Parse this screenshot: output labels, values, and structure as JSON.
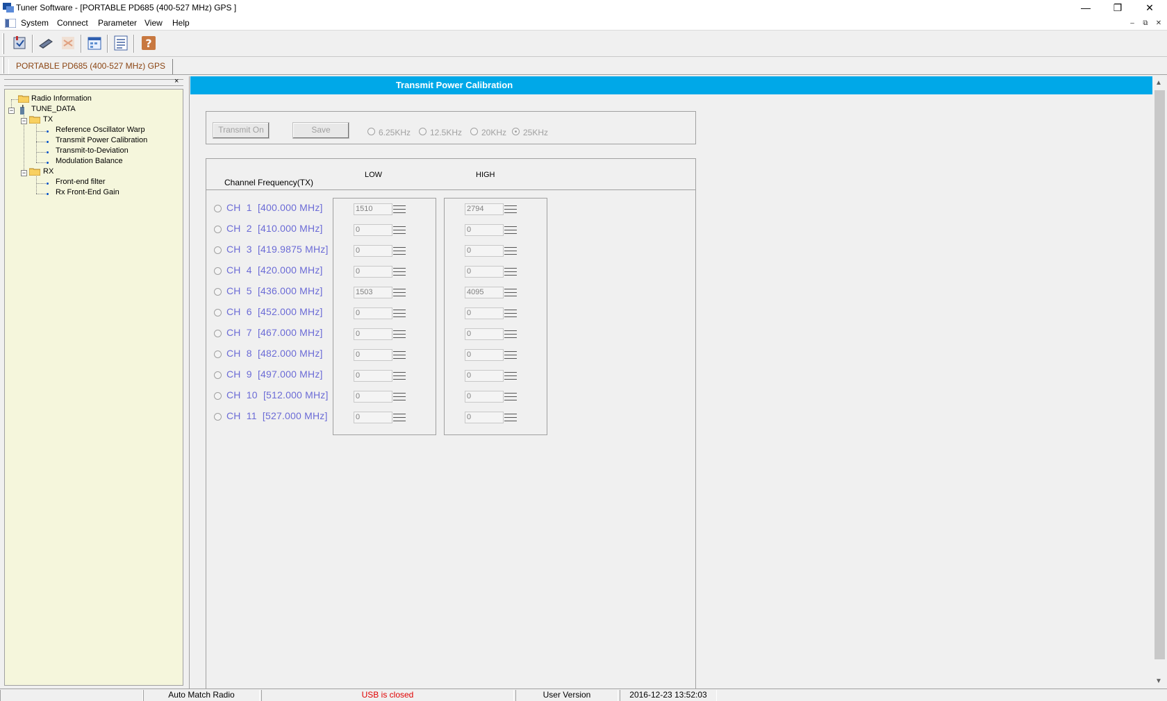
{
  "window": {
    "title": "Tuner Software - [PORTABLE PD685  (400-527 MHz) GPS ]",
    "minimize_glyph": "—",
    "restore_glyph": "❐",
    "close_glyph": "✕"
  },
  "menu": {
    "items": [
      "System",
      "Connect",
      "Parameter",
      "View",
      "Help"
    ],
    "mdi_minimize": "–",
    "mdi_restore": "⧉",
    "mdi_close": "✕"
  },
  "toolbar": {
    "icons": [
      "radio-read-icon",
      "usb-connect-icon",
      "disconnect-icon",
      "calendar-icon",
      "list-icon",
      "help-icon"
    ]
  },
  "tabs": [
    {
      "label": "PORTABLE PD685  (400-527 MHz) GPS"
    }
  ],
  "tree": {
    "close_glyph": "×",
    "nodes": [
      {
        "label": "Radio Information"
      },
      {
        "label": "TUNE_DATA"
      },
      {
        "label": "TX"
      },
      {
        "label": "Reference Oscillator Warp"
      },
      {
        "label": "Transmit Power Calibration"
      },
      {
        "label": "Transmit-to-Deviation"
      },
      {
        "label": "Modulation Balance"
      },
      {
        "label": "RX"
      },
      {
        "label": "Front-end filter"
      },
      {
        "label": "Rx Front-End Gain"
      }
    ],
    "expand_glyph": "−"
  },
  "panel": {
    "title": "Transmit Power Calibration",
    "transmit_on_label": "Transmit On",
    "save_label": "Save",
    "bandwidths": [
      "6.25KHz",
      "12.5KHz",
      "20KHz",
      "25KHz"
    ],
    "selected_bandwidth": "25KHz",
    "channel_header": "Channel  Frequency(TX)",
    "low_header": "LOW",
    "high_header": "HIGH",
    "channels": [
      {
        "label": "CH  1  [400.000 MHz]",
        "low": "1510",
        "high": "2794"
      },
      {
        "label": "CH  2  [410.000 MHz]",
        "low": "0",
        "high": "0"
      },
      {
        "label": "CH  3  [419.9875 MHz]",
        "low": "0",
        "high": "0"
      },
      {
        "label": "CH  4  [420.000 MHz]",
        "low": "0",
        "high": "0"
      },
      {
        "label": "CH  5  [436.000 MHz]",
        "low": "1503",
        "high": "4095"
      },
      {
        "label": "CH  6  [452.000 MHz]",
        "low": "0",
        "high": "0"
      },
      {
        "label": "CH  7  [467.000 MHz]",
        "low": "0",
        "high": "0"
      },
      {
        "label": "CH  8  [482.000 MHz]",
        "low": "0",
        "high": "0"
      },
      {
        "label": "CH  9  [497.000 MHz]",
        "low": "0",
        "high": "0"
      },
      {
        "label": "CH  10  [512.000 MHz]",
        "low": "0",
        "high": "0"
      },
      {
        "label": "CH  11  [527.000 MHz]",
        "low": "0",
        "high": "0"
      }
    ]
  },
  "scrollbar": {
    "up": "▲",
    "down": "▼"
  },
  "status": {
    "auto_match": "Auto Match Radio",
    "usb_state": "USB is closed",
    "version": "User Version",
    "datetime": "2016-12-23  13:52:03",
    "usb_color": "#e00000"
  }
}
